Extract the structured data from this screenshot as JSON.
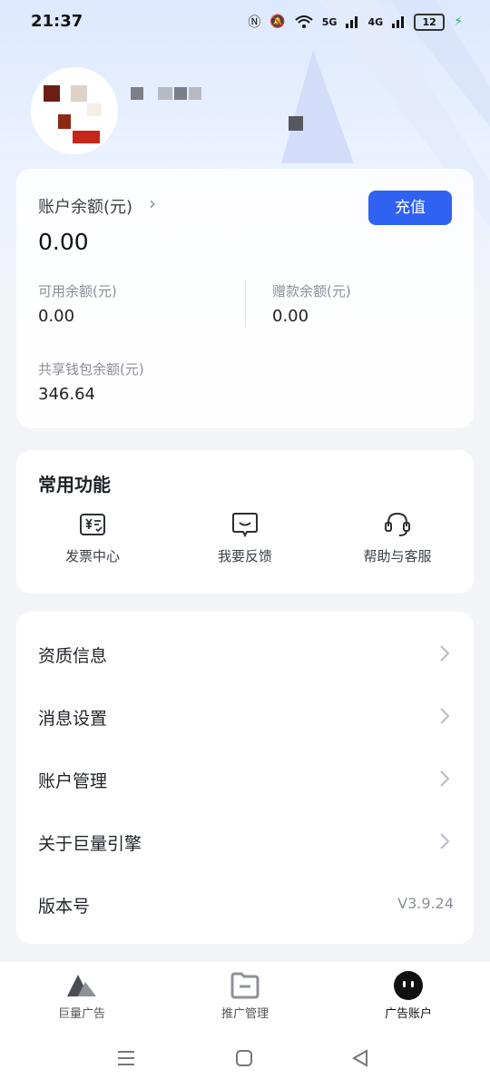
{
  "status_bar": {
    "time": "21:37",
    "signal1": "5G",
    "signal2": "4G",
    "battery": "12"
  },
  "balance": {
    "title": "账户余额(元)",
    "value": "0.00",
    "recharge_label": "充值",
    "available_label": "可用余额(元)",
    "available_value": "0.00",
    "gift_label": "赠款余额(元)",
    "gift_value": "0.00",
    "shared_label": "共享钱包余额(元)",
    "shared_value": "346.64"
  },
  "functions": {
    "title": "常用功能",
    "items": [
      {
        "label": "发票中心",
        "icon": "invoice-icon"
      },
      {
        "label": "我要反馈",
        "icon": "feedback-icon"
      },
      {
        "label": "帮助与客服",
        "icon": "headset-icon"
      }
    ]
  },
  "menu": {
    "items": [
      {
        "label": "资质信息"
      },
      {
        "label": "消息设置"
      },
      {
        "label": "账户管理"
      },
      {
        "label": "关于巨量引擎"
      },
      {
        "label": "版本号",
        "value": "V3.9.24"
      }
    ]
  },
  "tabbar": {
    "items": [
      {
        "label": "巨量广告",
        "icon": "ocean-logo-icon"
      },
      {
        "label": "推广管理",
        "icon": "folder-icon"
      },
      {
        "label": "广告账户",
        "icon": "account-face-icon",
        "active": true
      }
    ]
  },
  "colors": {
    "accent": "#2f62f0",
    "background": "#f3f4f7"
  }
}
